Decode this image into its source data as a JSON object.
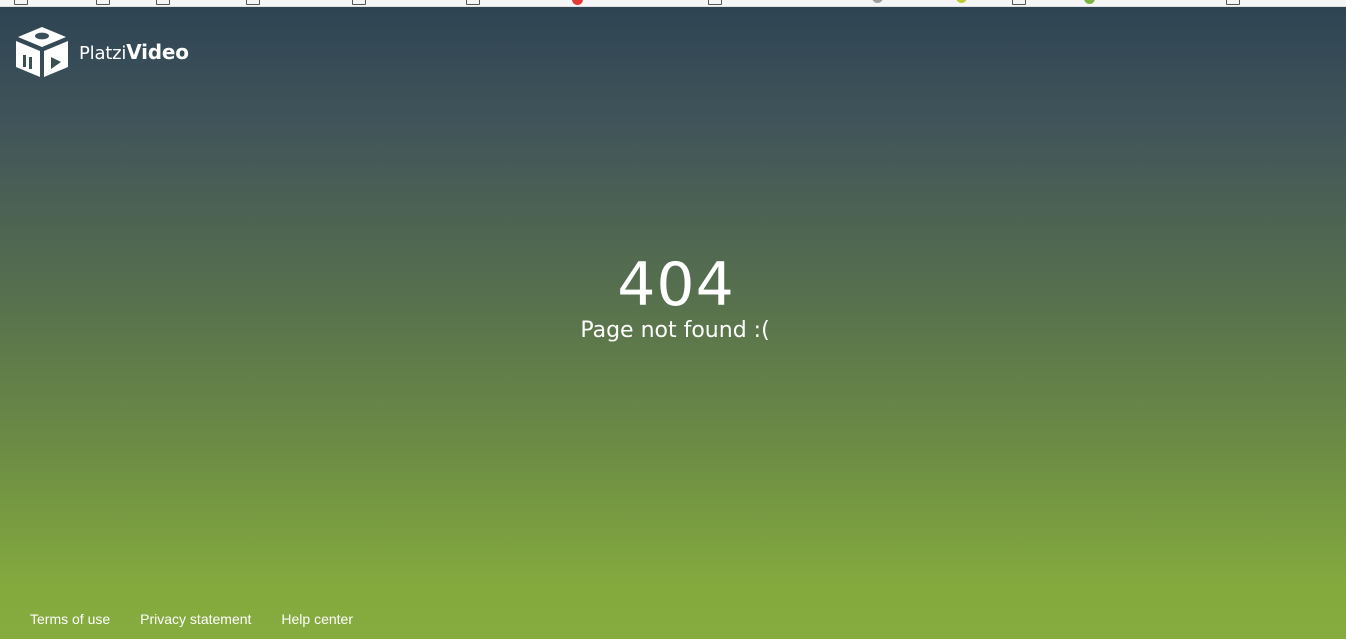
{
  "brand": {
    "name_light": "Platzi",
    "name_bold": "Video",
    "icon": "platzi-video-cube-logo",
    "color": "#ffffff"
  },
  "error": {
    "code": "404",
    "message": "Page not found :("
  },
  "footer": {
    "links": [
      {
        "label": "Terms of use"
      },
      {
        "label": "Privacy statement"
      },
      {
        "label": "Help center"
      }
    ]
  },
  "theme": {
    "gradient_top": "#2e4453",
    "gradient_bottom": "#86ab3f",
    "text": "#ffffff"
  }
}
